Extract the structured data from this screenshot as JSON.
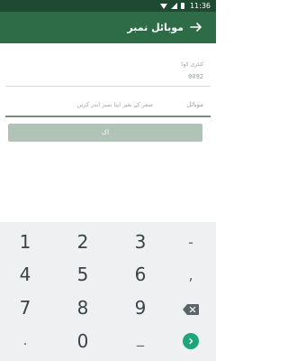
{
  "status_bar": {
    "time": "11:36"
  },
  "app_bar": {
    "title": "موبائل نمبر"
  },
  "form": {
    "code_label": "کنٹری کوڈ",
    "code_value": "0092",
    "mobile_label": "موبائل",
    "phone_placeholder": "صفر کے بغیر اپنا نمبر اندر کریں",
    "ok_label": "اک"
  },
  "keypad": {
    "rows": [
      [
        "1",
        "2",
        "3",
        "-"
      ],
      [
        "4",
        "5",
        "6",
        ","
      ],
      [
        "7",
        "8",
        "9",
        "backspace"
      ],
      [
        ".",
        "0",
        "_",
        "enter"
      ]
    ],
    "accent_color": "#1ea67a"
  },
  "colors": {
    "status_bar": "#1f4a32",
    "app_bar": "#2e6b47",
    "button_disabled": "#b0c3b6"
  }
}
